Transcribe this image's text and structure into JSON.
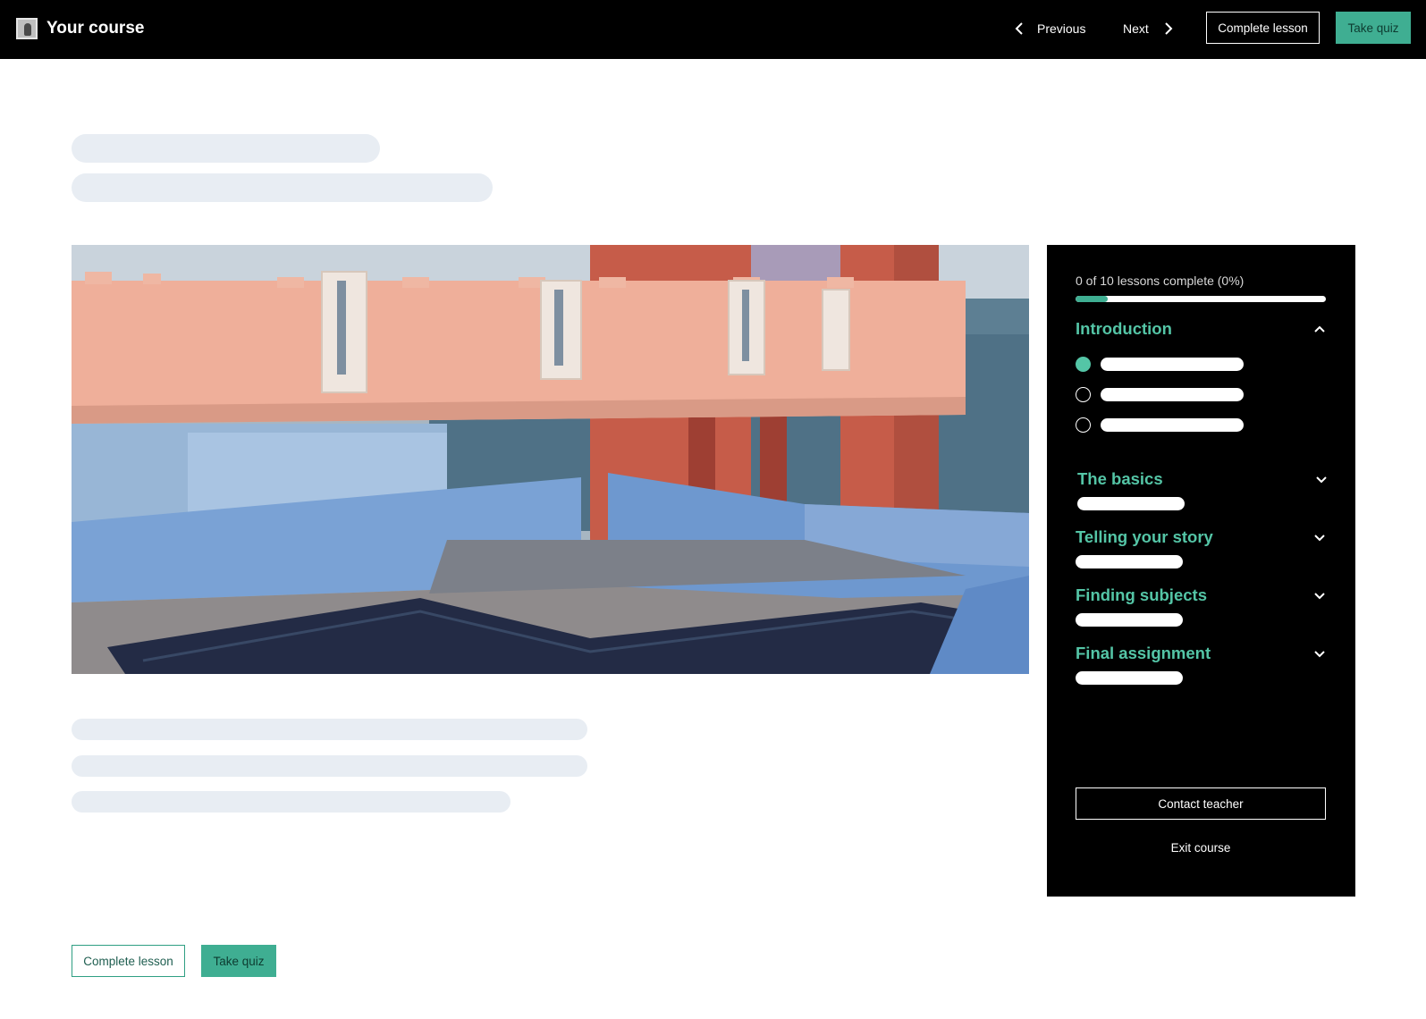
{
  "header": {
    "title": "Your course",
    "logo_icon": "camera-logo-icon",
    "nav": {
      "previous_label": "Previous",
      "next_label": "Next"
    },
    "complete_lesson_label": "Complete lesson",
    "take_quiz_label": "Take quiz"
  },
  "main": {
    "hero_image": "pastel-architecture-rooftop-pool"
  },
  "sidebar": {
    "progress_text": "0 of 10 lessons complete (0%)",
    "progress_fraction": 0.13,
    "sections": [
      {
        "title": "Introduction",
        "expanded": true,
        "icon": "chevron-up-icon",
        "lessons": [
          {
            "state": "current"
          },
          {
            "state": "incomplete"
          },
          {
            "state": "incomplete"
          }
        ]
      },
      {
        "title": "The basics",
        "expanded": false,
        "icon": "chevron-down-icon"
      },
      {
        "title": "Telling your story",
        "expanded": false,
        "icon": "chevron-down-icon"
      },
      {
        "title": "Finding subjects",
        "expanded": false,
        "icon": "chevron-down-icon"
      },
      {
        "title": "Final assignment",
        "expanded": false,
        "icon": "chevron-down-icon"
      }
    ],
    "contact_label": "Contact teacher",
    "exit_label": "Exit course"
  },
  "footer_actions": {
    "complete_lesson_label": "Complete lesson",
    "take_quiz_label": "Take quiz"
  },
  "colors": {
    "accent": "#3fae92",
    "accent_text": "#54c5a6",
    "skeleton": "#e8edf3",
    "topbar": "#000000"
  }
}
